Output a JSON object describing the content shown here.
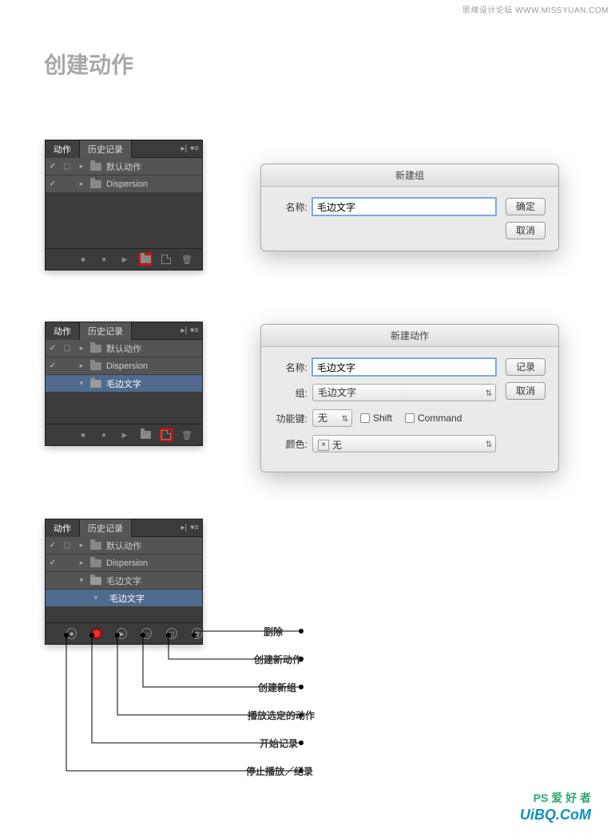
{
  "watermark_top": "思缘设计论坛  WWW.MISSYUAN.COM",
  "page_title": "创建动作",
  "tabs": {
    "actions": "动作",
    "history": "历史记录"
  },
  "panel1": {
    "items": [
      {
        "label": "默认动作"
      },
      {
        "label": "Dispersion"
      }
    ]
  },
  "panel2": {
    "items": [
      {
        "label": "默认动作"
      },
      {
        "label": "Dispersion"
      },
      {
        "label": "毛边文字"
      }
    ]
  },
  "panel3": {
    "items": [
      {
        "label": "默认动作"
      },
      {
        "label": "Dispersion"
      },
      {
        "label": "毛边文字"
      },
      {
        "label": "毛边文字"
      }
    ]
  },
  "dialog1": {
    "title": "新建组",
    "name_label": "名称:",
    "name_value": "毛边文字",
    "ok": "确定",
    "cancel": "取消"
  },
  "dialog2": {
    "title": "新建动作",
    "name_label": "名称:",
    "name_value": "毛边文字",
    "group_label": "组:",
    "group_value": "毛边文字",
    "fkey_label": "功能键:",
    "fkey_value": "无",
    "shift": "Shift",
    "command": "Command",
    "color_label": "颜色:",
    "color_value": "无",
    "record": "记录",
    "cancel": "取消"
  },
  "callouts": {
    "delete": "删除",
    "new_action": "创建新动作",
    "new_group": "创建新组",
    "play": "播放选定的动作",
    "record": "开始记录",
    "stop": "停止播放／纪录"
  },
  "wm_bottom1": "PS 爱 好 者",
  "wm_bottom2": "UiBQ.CoM"
}
